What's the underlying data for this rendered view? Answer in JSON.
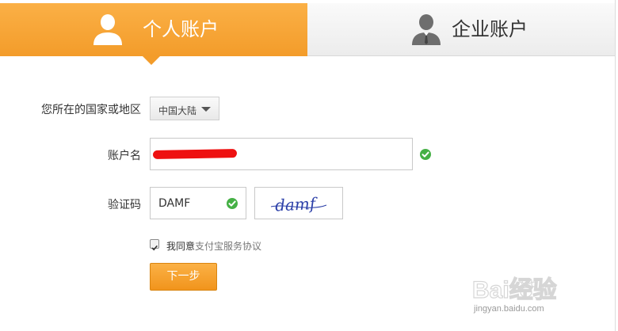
{
  "tabs": {
    "personal": {
      "label": "个人账户",
      "icon": "user-icon",
      "active": true
    },
    "business": {
      "label": "企业账户",
      "icon": "business-user-icon",
      "active": false
    }
  },
  "form": {
    "country_label": "您所在的国家或地区",
    "country_value": "中国大陆",
    "account_label": "账户名",
    "account_value_redacted": true,
    "captcha_label": "验证码",
    "captcha_value": "DAMF",
    "captcha_image_text": "damf"
  },
  "agreement": {
    "checked": true,
    "prefix": "我同意",
    "link": "支付宝服务协议"
  },
  "actions": {
    "next_label": "下一步"
  },
  "watermark": {
    "brand": "Bai经验",
    "url": "jingyan.baidu.com"
  },
  "colors": {
    "accent_orange": "#f39c2a",
    "success_green": "#45b045",
    "redaction_red": "#ee1111",
    "captcha_blue": "#2b3fa8"
  }
}
